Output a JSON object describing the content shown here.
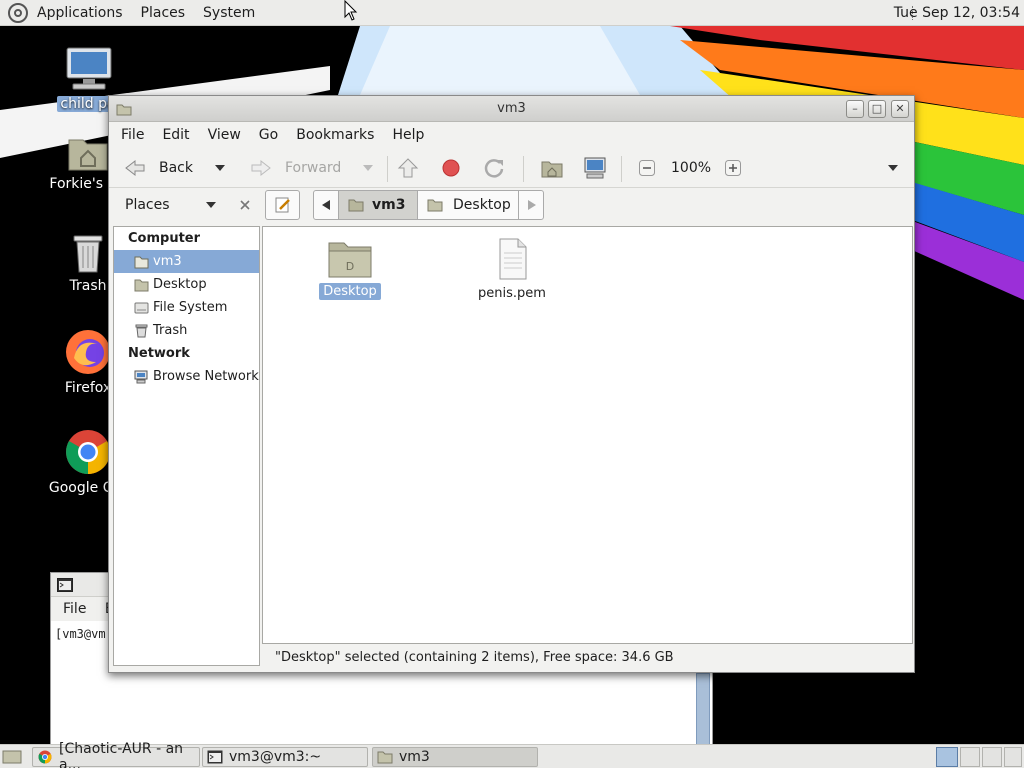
{
  "top_panel": {
    "menus": [
      "Applications",
      "Places",
      "System"
    ],
    "clock": "Tue Sep 12, 03:54"
  },
  "desktop": {
    "icons": [
      {
        "label": "child po",
        "icon": "computer-icon",
        "selected": true
      },
      {
        "label": "Forkie's Ho",
        "icon": "home-folder-icon"
      },
      {
        "label": "Trash",
        "icon": "trash-icon"
      },
      {
        "label": "Firefox",
        "icon": "firefox-icon"
      },
      {
        "label": "Google Chr",
        "icon": "chrome-icon"
      }
    ]
  },
  "terminal": {
    "menu_file": "File",
    "menu_edit": "E",
    "prompt": "[vm3@vm"
  },
  "file_manager": {
    "title": "vm3",
    "menus": [
      "File",
      "Edit",
      "View",
      "Go",
      "Bookmarks",
      "Help"
    ],
    "toolbar": {
      "back": "Back",
      "forward": "Forward",
      "zoom": "100%"
    },
    "sidebar": {
      "header": "Places",
      "sections": [
        {
          "title": "Computer",
          "items": [
            {
              "label": "vm3",
              "icon": "home-folder-icon",
              "selected": true
            },
            {
              "label": "Desktop",
              "icon": "desktop-folder-icon"
            },
            {
              "label": "File System",
              "icon": "drive-icon"
            },
            {
              "label": "Trash",
              "icon": "trash-icon"
            }
          ]
        },
        {
          "title": "Network",
          "items": [
            {
              "label": "Browse Network",
              "icon": "network-icon"
            }
          ]
        }
      ]
    },
    "path": [
      "vm3",
      "Desktop"
    ],
    "files": [
      {
        "name": "Desktop",
        "type": "folder",
        "selected": true
      },
      {
        "name": "penis.pem",
        "type": "file"
      }
    ],
    "status": "\"Desktop\" selected (containing 2 items), Free space: 34.6 GB"
  },
  "taskbar": {
    "tasks": [
      {
        "label": "[Chaotic-AUR - an a...",
        "icon": "chrome-icon"
      },
      {
        "label": "vm3@vm3:~",
        "icon": "terminal-icon"
      },
      {
        "label": "vm3",
        "icon": "folder-icon",
        "active": true
      }
    ]
  },
  "colors": {
    "selection": "#86a9d6",
    "panel": "#ececea",
    "window": "#f2f2f0"
  }
}
